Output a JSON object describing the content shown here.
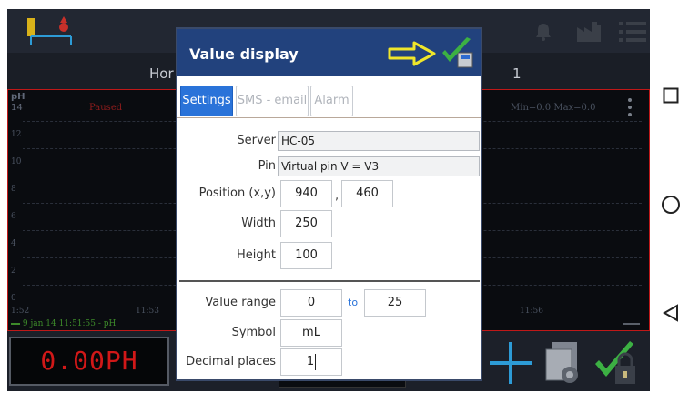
{
  "navbar": {
    "home_label": "Hor",
    "right_label": "1"
  },
  "chart": {
    "unit": "pH",
    "y_top": "14",
    "paused": "Paused",
    "minmax": "Min=0.0  Max=0.0",
    "y_ticks": [
      "12",
      "10",
      "8",
      "6",
      "4",
      "2",
      "0"
    ],
    "x_ticks": [
      "1:52",
      "11:53",
      "11:56"
    ],
    "legend": "9 jan 14 11:51:55 - pH"
  },
  "lcd": {
    "value": "0.00PH"
  },
  "dialog": {
    "title": "Value display",
    "tabs": [
      {
        "label": "Settings",
        "active": true
      },
      {
        "label": "SMS - email",
        "active": false
      },
      {
        "label": "Alarm",
        "active": false
      }
    ],
    "server": {
      "label": "Server",
      "value": "HC-05"
    },
    "pin": {
      "label": "Pin",
      "value": "Virtual pin V = V3"
    },
    "position": {
      "label": "Position (x,y)",
      "x": "940",
      "y": "460",
      "separator": ","
    },
    "width": {
      "label": "Width",
      "value": "250"
    },
    "height": {
      "label": "Height",
      "value": "100"
    },
    "value_range": {
      "label": "Value range",
      "from": "0",
      "to_label": "to",
      "to": "25"
    },
    "symbol": {
      "label": "Symbol",
      "value": "mL"
    },
    "decimal_places": {
      "label": "Decimal places",
      "value": "1"
    }
  },
  "colors": {
    "header": "#22427d",
    "tab_active": "#2a73d9",
    "arrow": "#f0e62a",
    "check": "#3cb043",
    "lcd": "#d11818"
  }
}
